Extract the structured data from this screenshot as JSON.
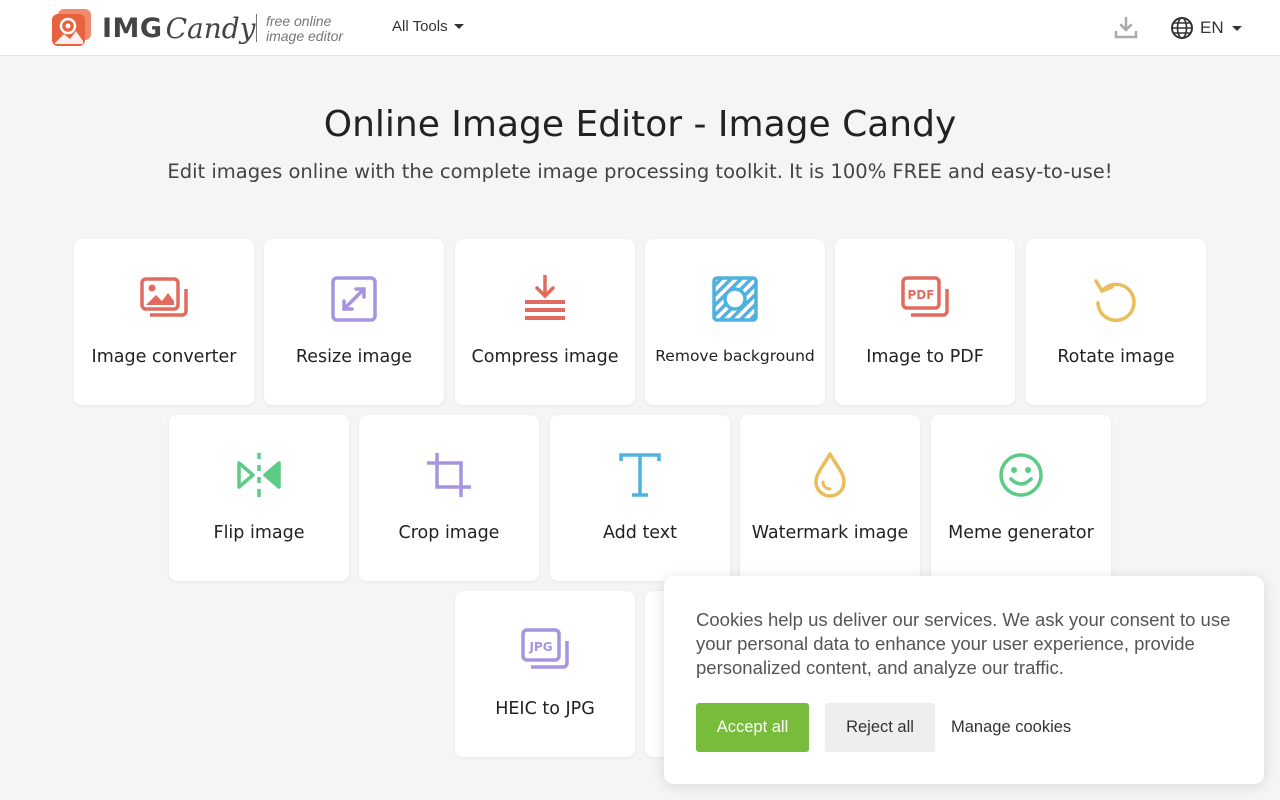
{
  "header": {
    "logo_img": "IMG",
    "logo_candy": "Candy",
    "tagline_line1": "free online",
    "tagline_line2": "image editor",
    "all_tools": "All Tools",
    "language": "EN"
  },
  "hero": {
    "title": "Online Image Editor - Image Candy",
    "subtitle": "Edit images online with the complete image processing toolkit. It is 100% FREE and easy-to-use!"
  },
  "tools": [
    {
      "label": "Image converter",
      "icon": "images-icon",
      "color": "#e06b5e"
    },
    {
      "label": "Resize image",
      "icon": "resize-icon",
      "color": "#a794e0"
    },
    {
      "label": "Compress image",
      "icon": "compress-icon",
      "color": "#e06b5e"
    },
    {
      "label": "Remove background",
      "icon": "remove-background-icon",
      "color": "#4db3de"
    },
    {
      "label": "Image to PDF",
      "icon": "pdf-icon",
      "color": "#e06b5e"
    },
    {
      "label": "Rotate image",
      "icon": "rotate-icon",
      "color": "#ebbd5a"
    },
    {
      "label": "Flip image",
      "icon": "flip-icon",
      "color": "#5ccb86"
    },
    {
      "label": "Crop image",
      "icon": "crop-icon",
      "color": "#a794e0"
    },
    {
      "label": "Add text",
      "icon": "text-icon",
      "color": "#4db3de"
    },
    {
      "label": "Watermark image",
      "icon": "watermark-drop-icon",
      "color": "#ebbd5a"
    },
    {
      "label": "Meme generator",
      "icon": "smiley-icon",
      "color": "#5ccb86"
    },
    {
      "label": "HEIC to JPG",
      "icon": "jpg-icon",
      "color": "#a794e0"
    }
  ],
  "cookie": {
    "text": "Cookies help us deliver our services. We ask your consent to use your personal data to enhance your user experience, provide personalized content, and analyze our traffic.",
    "accept": "Accept all",
    "reject": "Reject all",
    "manage": "Manage cookies"
  }
}
